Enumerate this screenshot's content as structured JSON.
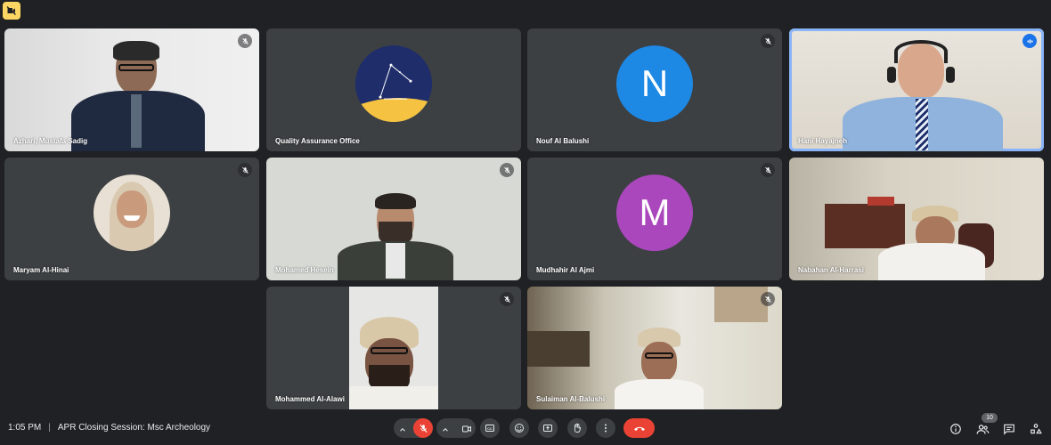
{
  "meeting": {
    "time": "1:05 PM",
    "separator": "|",
    "title": "APR Closing Session: Msc Archeology",
    "participant_count": "10"
  },
  "participants": [
    {
      "name": "Azhari, Mustafa Sadig",
      "type": "video",
      "muted": true
    },
    {
      "name": "Quality Assurance Office",
      "type": "logo",
      "muted": false
    },
    {
      "name": "Nouf Al Balushi",
      "type": "letter",
      "letter": "N",
      "color": "#1e88e5",
      "muted": true
    },
    {
      "name": "Hani Hayajneh",
      "type": "video",
      "muted": false,
      "speaking": true
    },
    {
      "name": "Maryam Al-Hinai",
      "type": "photo",
      "muted": true
    },
    {
      "name": "Mohamed Hesein",
      "type": "video",
      "muted": true
    },
    {
      "name": "Mudhahir Al Ajmi",
      "type": "letter",
      "letter": "M",
      "color": "#ab47bc",
      "muted": true
    },
    {
      "name": "Nabahan Al-Harrasi",
      "type": "video",
      "muted": false
    },
    {
      "name": "Mohammed Al-Alawi",
      "type": "video",
      "muted": true
    },
    {
      "name": "Sulaiman Al-Balushi",
      "type": "video",
      "muted": true
    }
  ],
  "colors": {
    "background": "#202124",
    "tile": "#3c4043",
    "accent": "#8ab4f8",
    "end_call": "#ea4335",
    "notice": "#fdd663"
  },
  "controls": {
    "left": [
      "mic-off-icon",
      "camera-icon",
      "captions-icon",
      "emoji-icon",
      "present-icon",
      "raise-hand-icon",
      "more-icon",
      "end-call-icon"
    ],
    "right": [
      "info-icon",
      "people-icon",
      "chat-icon",
      "activities-icon"
    ],
    "captions_label": "CC"
  }
}
